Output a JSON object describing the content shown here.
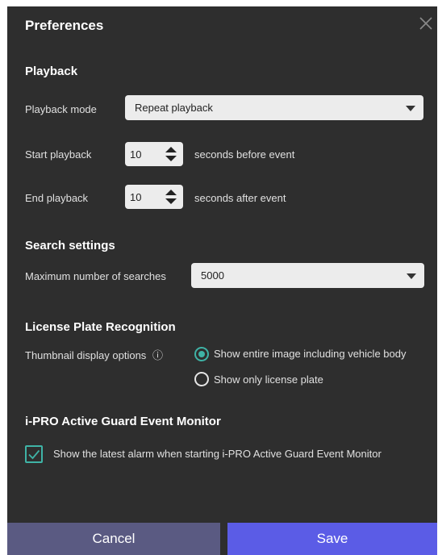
{
  "dialog": {
    "title": "Preferences"
  },
  "playback": {
    "heading": "Playback",
    "mode_label": "Playback mode",
    "mode_value": "Repeat playback",
    "start_label": "Start playback",
    "start_value": "10",
    "start_suffix": "seconds before event",
    "end_label": "End playback",
    "end_value": "10",
    "end_suffix": "seconds after event"
  },
  "search": {
    "heading": "Search settings",
    "max_label": "Maximum number of searches",
    "max_value": "5000"
  },
  "lpr": {
    "heading": "License Plate Recognition",
    "thumb_label": "Thumbnail display options",
    "info_icon": "ⓘ",
    "options": [
      {
        "label": "Show entire image including vehicle body",
        "selected": true
      },
      {
        "label": "Show only license plate",
        "selected": false
      }
    ]
  },
  "monitor": {
    "heading": "i-PRO Active Guard Event Monitor",
    "checkbox_label": "Show the latest alarm when starting i-PRO Active Guard Event Monitor",
    "checked": true
  },
  "footer": {
    "cancel_label": "Cancel",
    "save_label": "Save"
  },
  "colors": {
    "dialog_bg": "#2e2e2e",
    "accent": "#3fb3a6",
    "save_bg": "#5b5ce6",
    "cancel_bg": "#5a5a82"
  },
  "icons": {
    "close": "close-icon",
    "dropdown": "chevron-down-icon",
    "spin_up": "arrow-up-icon",
    "spin_down": "arrow-down-icon",
    "check": "check-icon",
    "info": "info-icon"
  }
}
